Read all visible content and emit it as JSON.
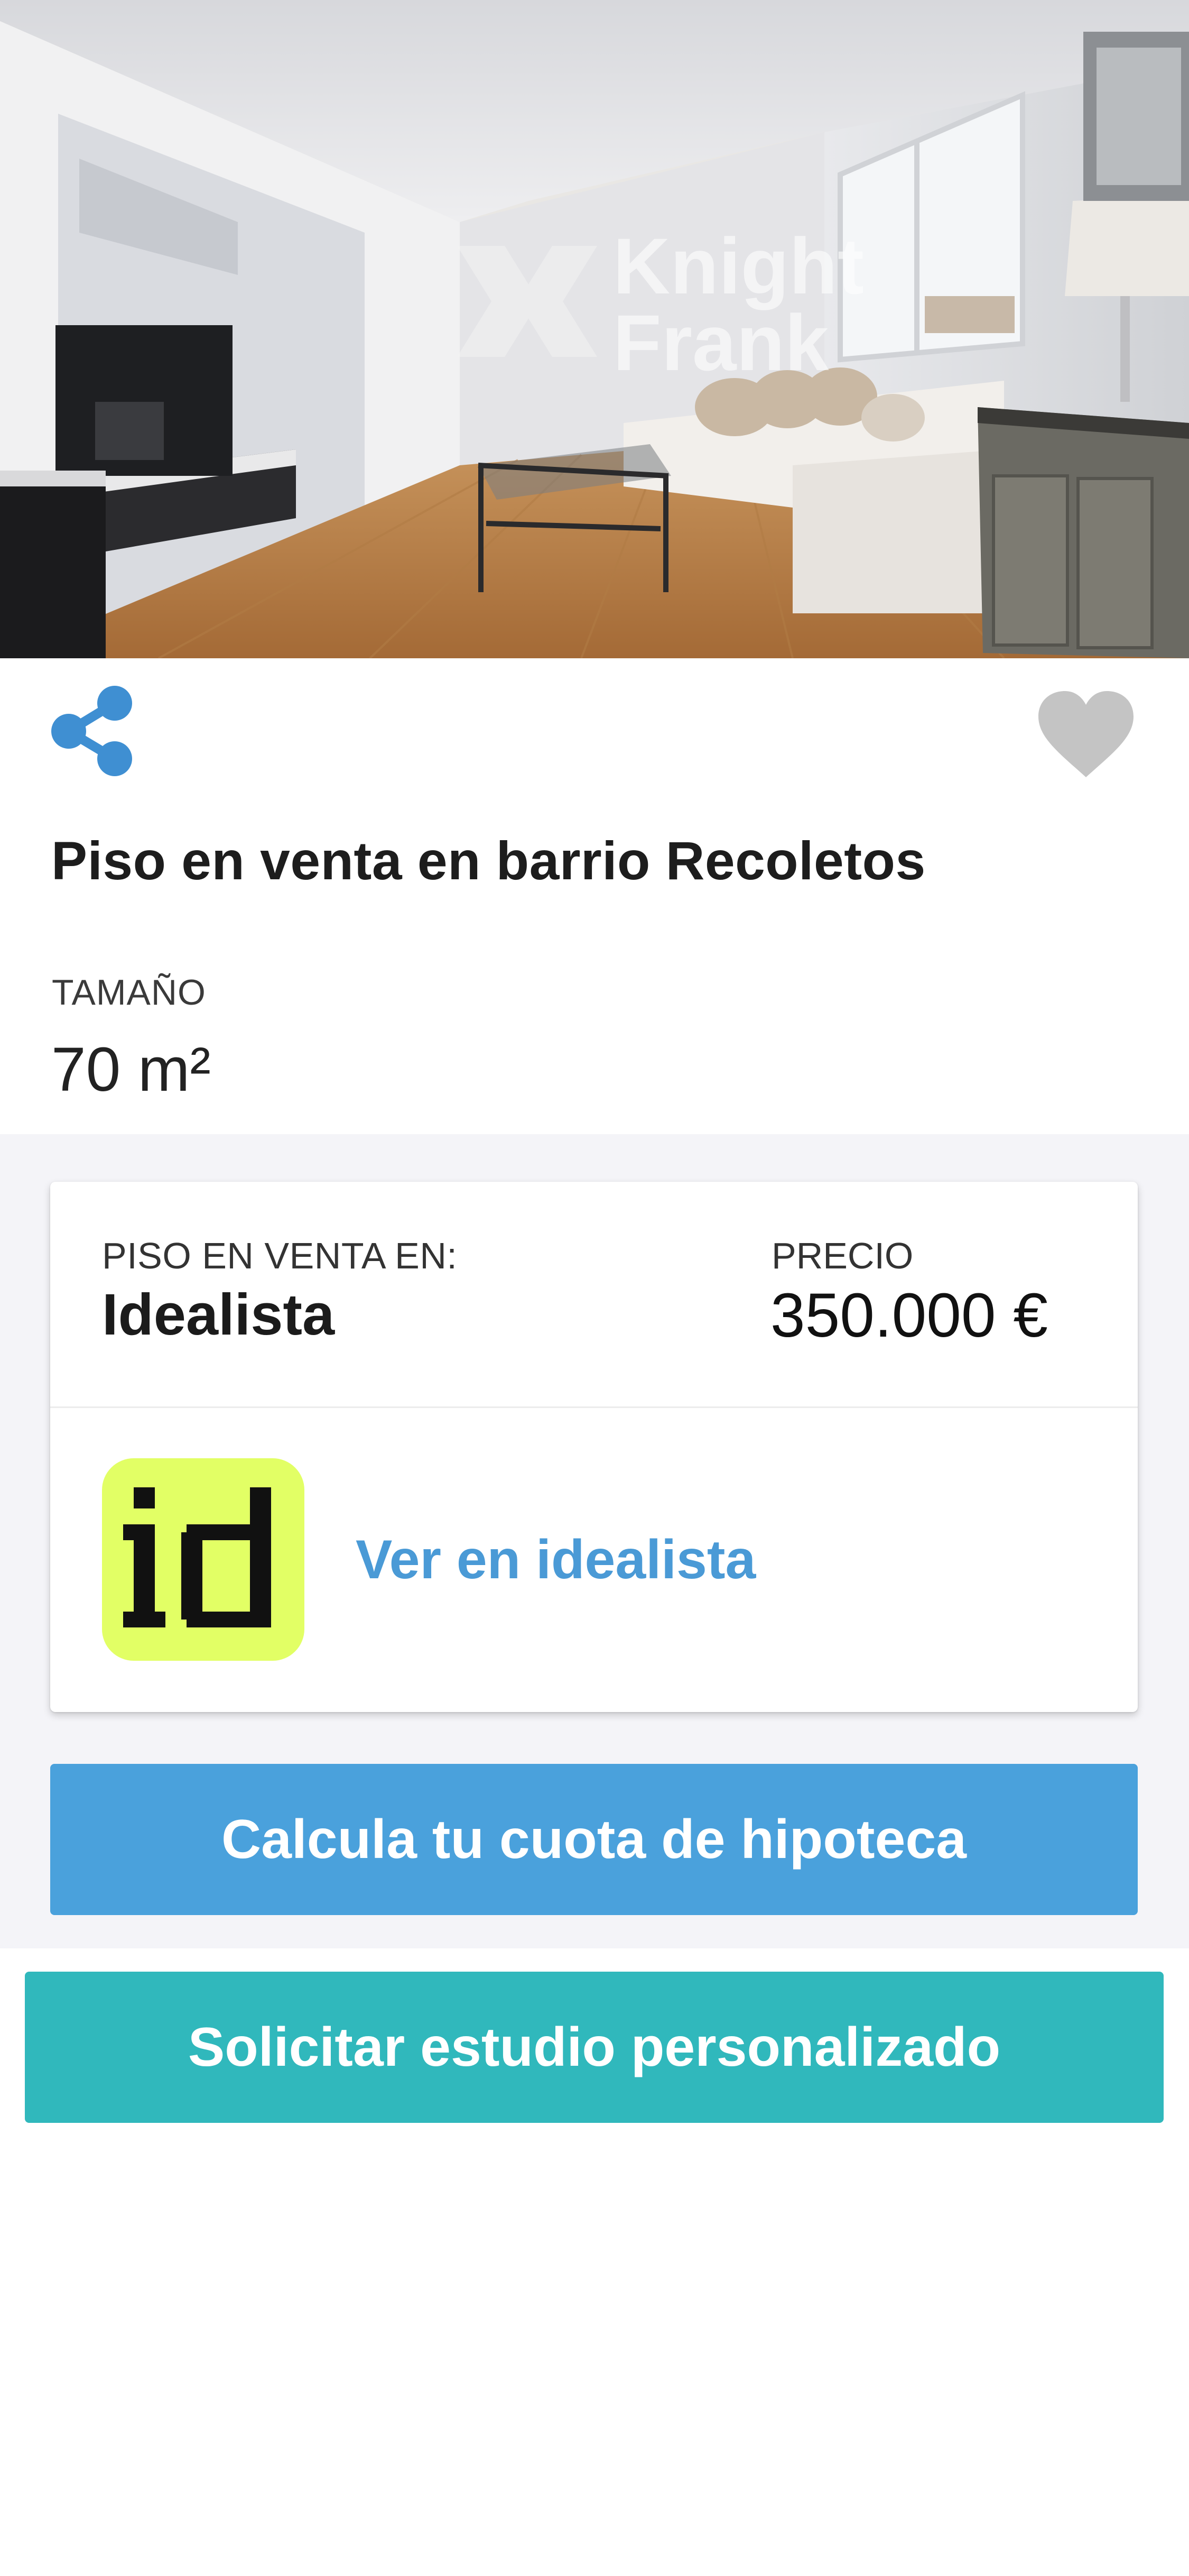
{
  "hero": {
    "watermark_line1": "Knight",
    "watermark_line2": "Frank"
  },
  "header": {
    "title": "Piso en venta en barrio Recoletos",
    "size_label": "TAMAÑO",
    "size_value": "70 m²"
  },
  "icons": {
    "share": "share-icon",
    "favorite": "heart-icon",
    "portal_logo": "idealista-logo"
  },
  "listing_card": {
    "portal_label": "PISO EN VENTA EN:",
    "portal_name": "Idealista",
    "price_label": "PRECIO",
    "price_value": "350.000 €",
    "link_label": "Ver en idealista",
    "logo_text": "id"
  },
  "buttons": {
    "mortgage": "Calcula tu cuota de hipoteca",
    "study": "Solicitar estudio personalizado"
  },
  "colors": {
    "accent_blue": "#4aa1dc",
    "link_blue": "#4a9ad6",
    "teal": "#30b8bc",
    "idealista_green": "#e2ff65",
    "favorite_grey": "#c4c4c4",
    "band_grey": "#f4f4f8"
  }
}
